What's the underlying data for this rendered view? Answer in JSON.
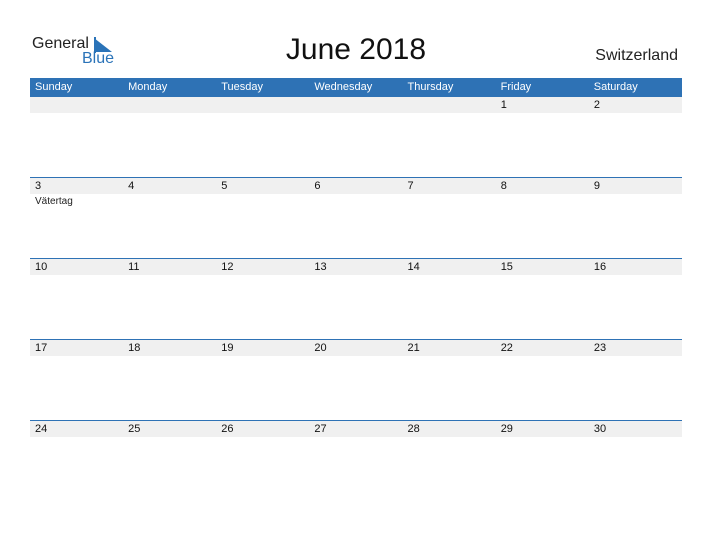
{
  "logo": {
    "general": "General",
    "blue": "Blue"
  },
  "title": "June 2018",
  "country": "Switzerland",
  "days": [
    "Sunday",
    "Monday",
    "Tuesday",
    "Wednesday",
    "Thursday",
    "Friday",
    "Saturday"
  ],
  "weeks": [
    [
      "",
      "",
      "",
      "",
      "",
      "1",
      "2"
    ],
    [
      "3",
      "4",
      "5",
      "6",
      "7",
      "8",
      "9"
    ],
    [
      "10",
      "11",
      "12",
      "13",
      "14",
      "15",
      "16"
    ],
    [
      "17",
      "18",
      "19",
      "20",
      "21",
      "22",
      "23"
    ],
    [
      "24",
      "25",
      "26",
      "27",
      "28",
      "29",
      "30"
    ]
  ],
  "events": {
    "1-0": "Vätertag"
  }
}
